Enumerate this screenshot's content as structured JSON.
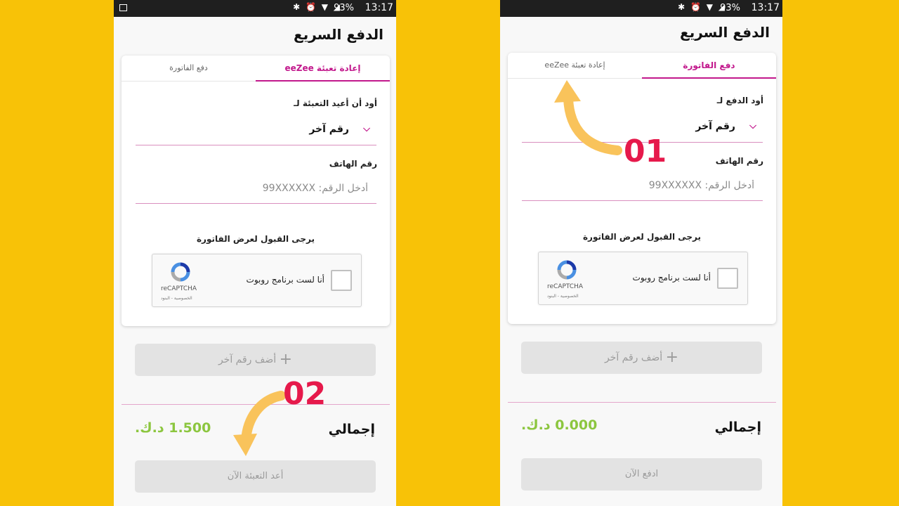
{
  "status_bar": {
    "icons": "✱ ⏰ ▼ ◢",
    "battery": "93%",
    "time": "13:17"
  },
  "screens": [
    {
      "title": "الدفع السريع",
      "tabs": [
        {
          "label": "دفع الفاتورة",
          "active": false
        },
        {
          "label": "إعادة تعبئة eeZee",
          "active": true
        }
      ],
      "select_label": "أود أن أعيد التعبئة لـ",
      "select_value": "رقم آخر",
      "phone_label": "رقم الهاتف",
      "phone_placeholder": "أدخل الرقم: 99XXXXXX",
      "accept_text": "يرجى القبول لعرض الفاتورة",
      "captcha": {
        "checkbox_label": "أنا لست برنامج روبوت",
        "brand": "reCAPTCHA",
        "links": "الخصوصية - البنود"
      },
      "add_number": "أضف رقم آخر",
      "total_label": "إجمالي",
      "total_amount": "1.500 د.ك.",
      "cta": "أعد التعبئة الآن",
      "annotation": "02"
    },
    {
      "title": "الدفع السريع",
      "tabs": [
        {
          "label": "دفع الفاتورة",
          "active": true
        },
        {
          "label": "إعادة تعبئة eeZee",
          "active": false
        }
      ],
      "select_label": "أود الدفع لـ",
      "select_value": "رقم آخر",
      "phone_label": "رقم الهاتف",
      "phone_placeholder": "أدخل الرقم: 99XXXXXX",
      "accept_text": "يرجى القبول لعرض الفاتورة",
      "captcha": {
        "checkbox_label": "أنا لست برنامج روبوت",
        "brand": "reCAPTCHA",
        "links": "الخصوصية - البنود"
      },
      "add_number": "أضف رقم آخر",
      "total_label": "إجمالي",
      "total_amount": "0.000 د.ك.",
      "cta": "ادفع الآن",
      "annotation": "01"
    }
  ],
  "colors": {
    "background": "#f8c207",
    "accent": "#c2188c",
    "amount": "#8cc63f",
    "annotation": "#e6194b",
    "arrow": "#f9c35b"
  }
}
